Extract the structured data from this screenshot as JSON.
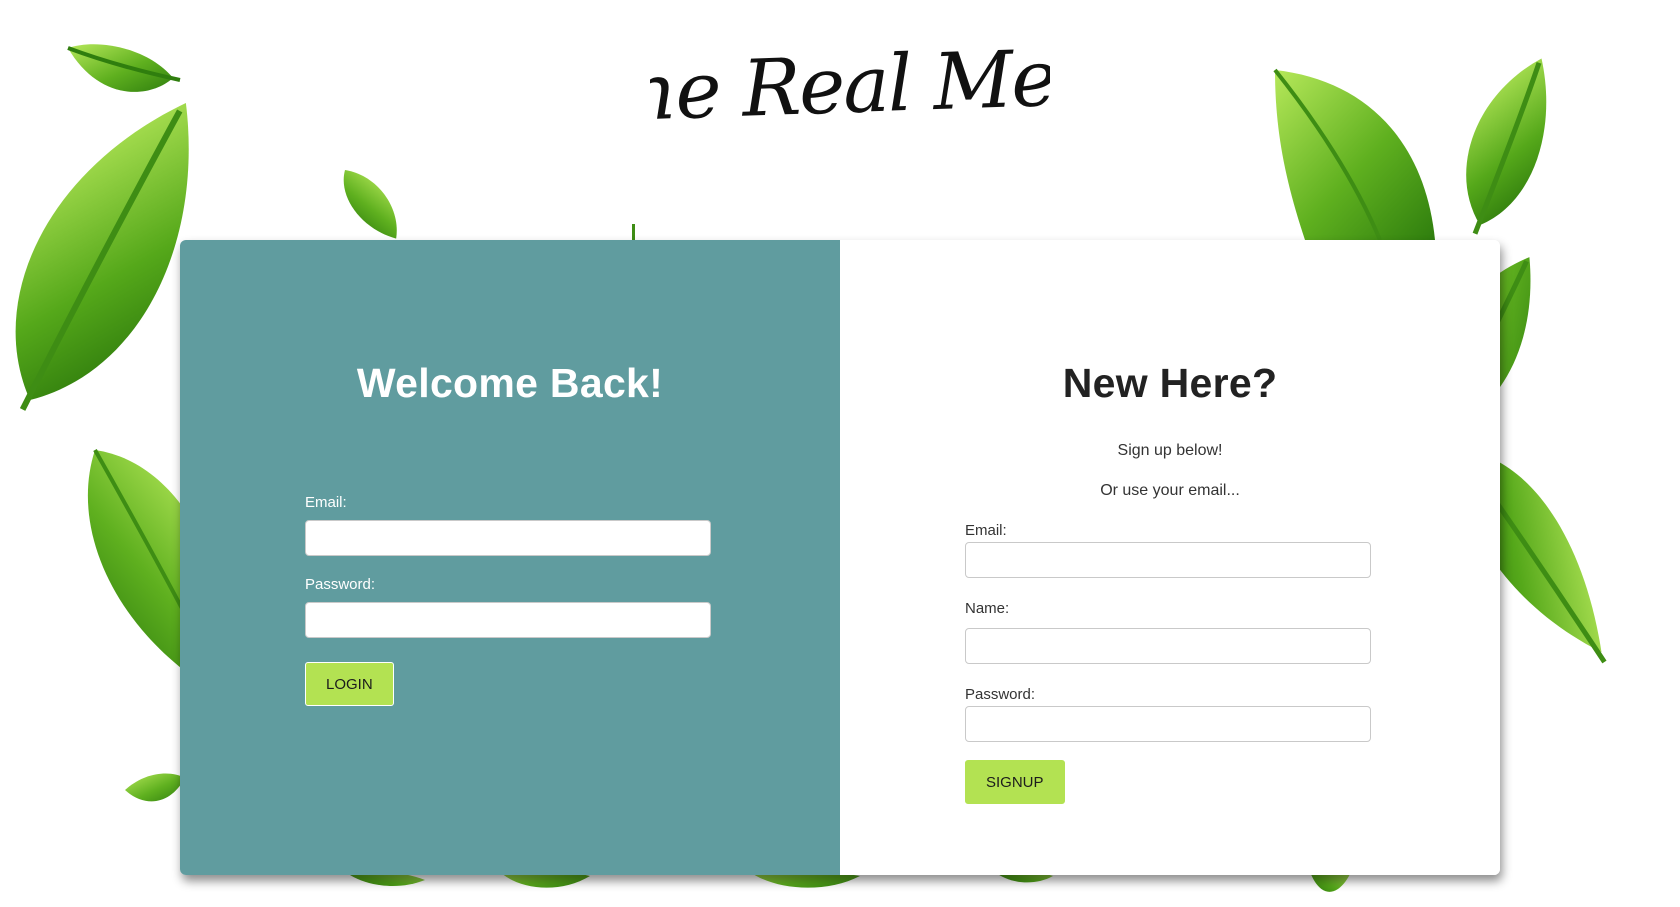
{
  "brand": {
    "logo_text": "The Real Meal"
  },
  "colors": {
    "login_panel": "#609c9f",
    "button": "#b3e252",
    "leaf_light": "#a6e24a",
    "leaf_dark": "#3f8a12"
  },
  "login": {
    "heading": "Welcome Back!",
    "email_label": "Email:",
    "email_value": "",
    "password_label": "Password:",
    "password_value": "",
    "button_label": "LOGIN"
  },
  "signup": {
    "heading": "New Here?",
    "subtitle": "Sign up below!",
    "hint": "Or use your email...",
    "email_label": "Email:",
    "email_value": "",
    "name_label": "Name:",
    "name_value": "",
    "password_label": "Password:",
    "password_value": "",
    "button_label": "SIGNUP"
  },
  "background": {
    "decoration": "leaf-icon"
  }
}
